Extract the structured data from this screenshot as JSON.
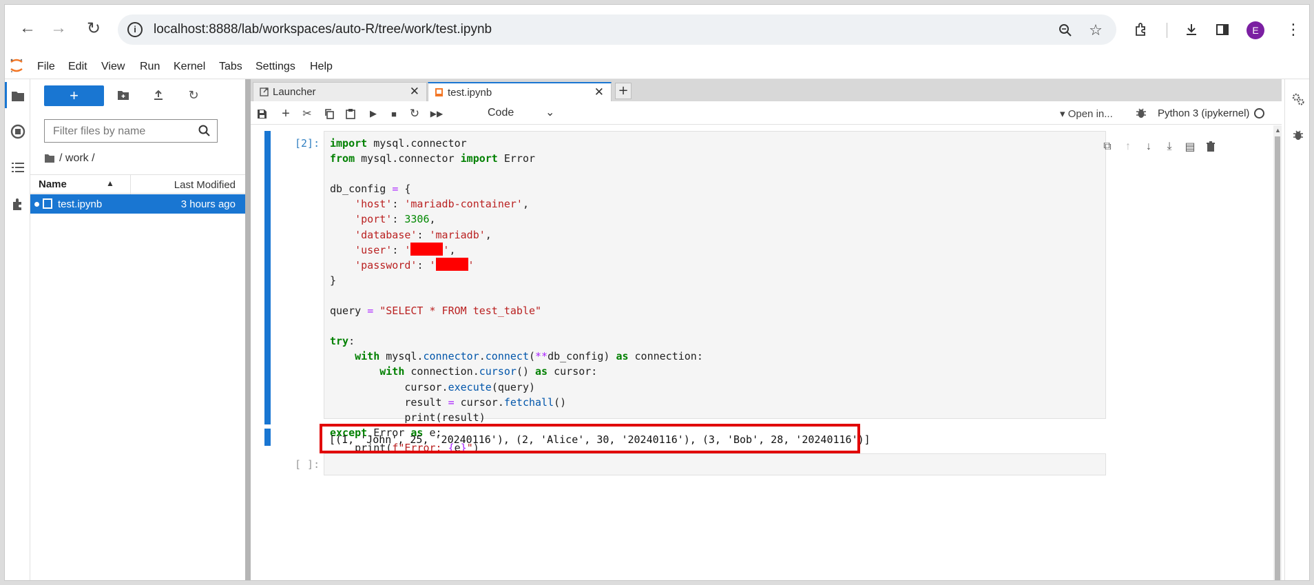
{
  "browser": {
    "url": "localhost:8888/lab/workspaces/auto-R/tree/work/test.ipynb",
    "profile_initial": "E",
    "profile_color": "#7b1fa2"
  },
  "menu": [
    "File",
    "Edit",
    "View",
    "Run",
    "Kernel",
    "Tabs",
    "Settings",
    "Help"
  ],
  "filebrowser": {
    "new_label": "+",
    "filter_placeholder": "Filter files by name",
    "breadcrumb": "/ work /",
    "col_name": "Name",
    "col_modified": "Last Modified",
    "files": [
      {
        "name": "test.ipynb",
        "modified": "3 hours ago",
        "selected": true
      }
    ]
  },
  "tabs": [
    {
      "label": "Launcher",
      "active": false
    },
    {
      "label": "test.ipynb",
      "active": true
    }
  ],
  "tab_add": "+",
  "toolbar": {
    "cell_type": "Code",
    "open_in": "Open in...",
    "kernel": "Python 3 (ipykernel)"
  },
  "cells": [
    {
      "prompt": "[2]:",
      "type": "code"
    },
    {
      "prompt": "[ ]:",
      "type": "code-empty"
    }
  ],
  "output_text": "[(1, 'John', 25, '20240116'), (2, 'Alice', 30, '20240116'), (3, 'Bob', 28, '20240116')]",
  "accent": "#1976d2",
  "highlight_color": "#e10000"
}
